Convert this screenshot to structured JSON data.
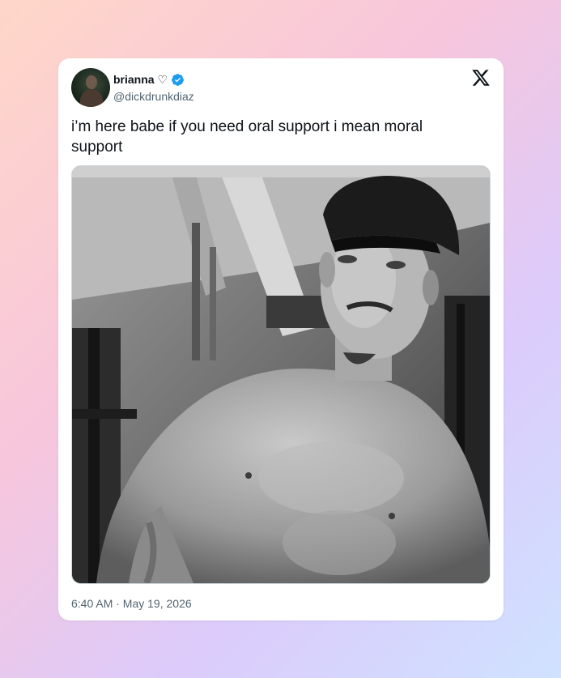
{
  "tweet": {
    "display_name": "brianna ♡",
    "handle": "@dickdrunkdiaz",
    "text": "i’m here babe if you need oral support i mean moral support",
    "timestamp": "6:40 AM · May 19, 2026",
    "verified": true
  },
  "icons": {
    "verified": "verified-badge-icon",
    "brand": "x-logo-icon"
  },
  "colors": {
    "verified_blue": "#1d9bf0",
    "text_primary": "#0f1419",
    "text_secondary": "#536471"
  }
}
